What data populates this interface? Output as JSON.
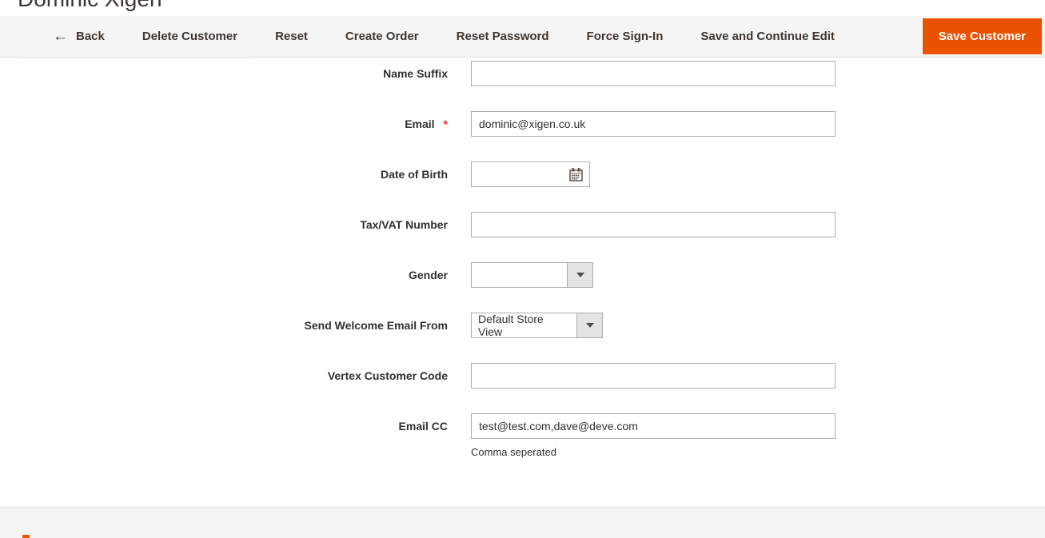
{
  "page": {
    "title": "Dominic Xigen"
  },
  "toolbar": {
    "back_label": "Back",
    "back_icon": "arrow-left-icon",
    "back_arrow_glyph": "←",
    "delete_customer_label": "Delete Customer",
    "reset_label": "Reset",
    "create_order_label": "Create Order",
    "reset_password_label": "Reset Password",
    "force_sign_in_label": "Force Sign-In",
    "save_and_continue_label": "Save and Continue Edit",
    "save_customer_label": "Save Customer",
    "primary_color": "#eb5202",
    "background_color": "#f5f5f5"
  },
  "form": {
    "fields": [
      {
        "label": "Name Suffix",
        "name": "name-suffix",
        "type": "text",
        "value": "",
        "required": false
      },
      {
        "label": "Email",
        "name": "email",
        "type": "text",
        "value": "dominic@xigen.co.uk",
        "required": true,
        "required_marker": "*"
      },
      {
        "label": "Date of Birth",
        "name": "date-of-birth",
        "type": "date",
        "value": "",
        "required": false,
        "icon": "calendar-icon"
      },
      {
        "label": "Tax/VAT Number",
        "name": "tax-vat-number",
        "type": "text",
        "value": "",
        "required": false
      },
      {
        "label": "Gender",
        "name": "gender",
        "type": "select",
        "value": "",
        "required": false
      },
      {
        "label": "Send Welcome Email From",
        "name": "send-welcome-email-from",
        "type": "select",
        "value": "Default Store View",
        "required": false
      },
      {
        "label": "Vertex Customer Code",
        "name": "vertex-customer-code",
        "type": "text",
        "value": "",
        "required": false
      },
      {
        "label": "Email CC",
        "name": "email-cc",
        "type": "text",
        "value": "test@test.com,dave@deve.com",
        "required": false,
        "note": "Comma seperated"
      }
    ]
  }
}
